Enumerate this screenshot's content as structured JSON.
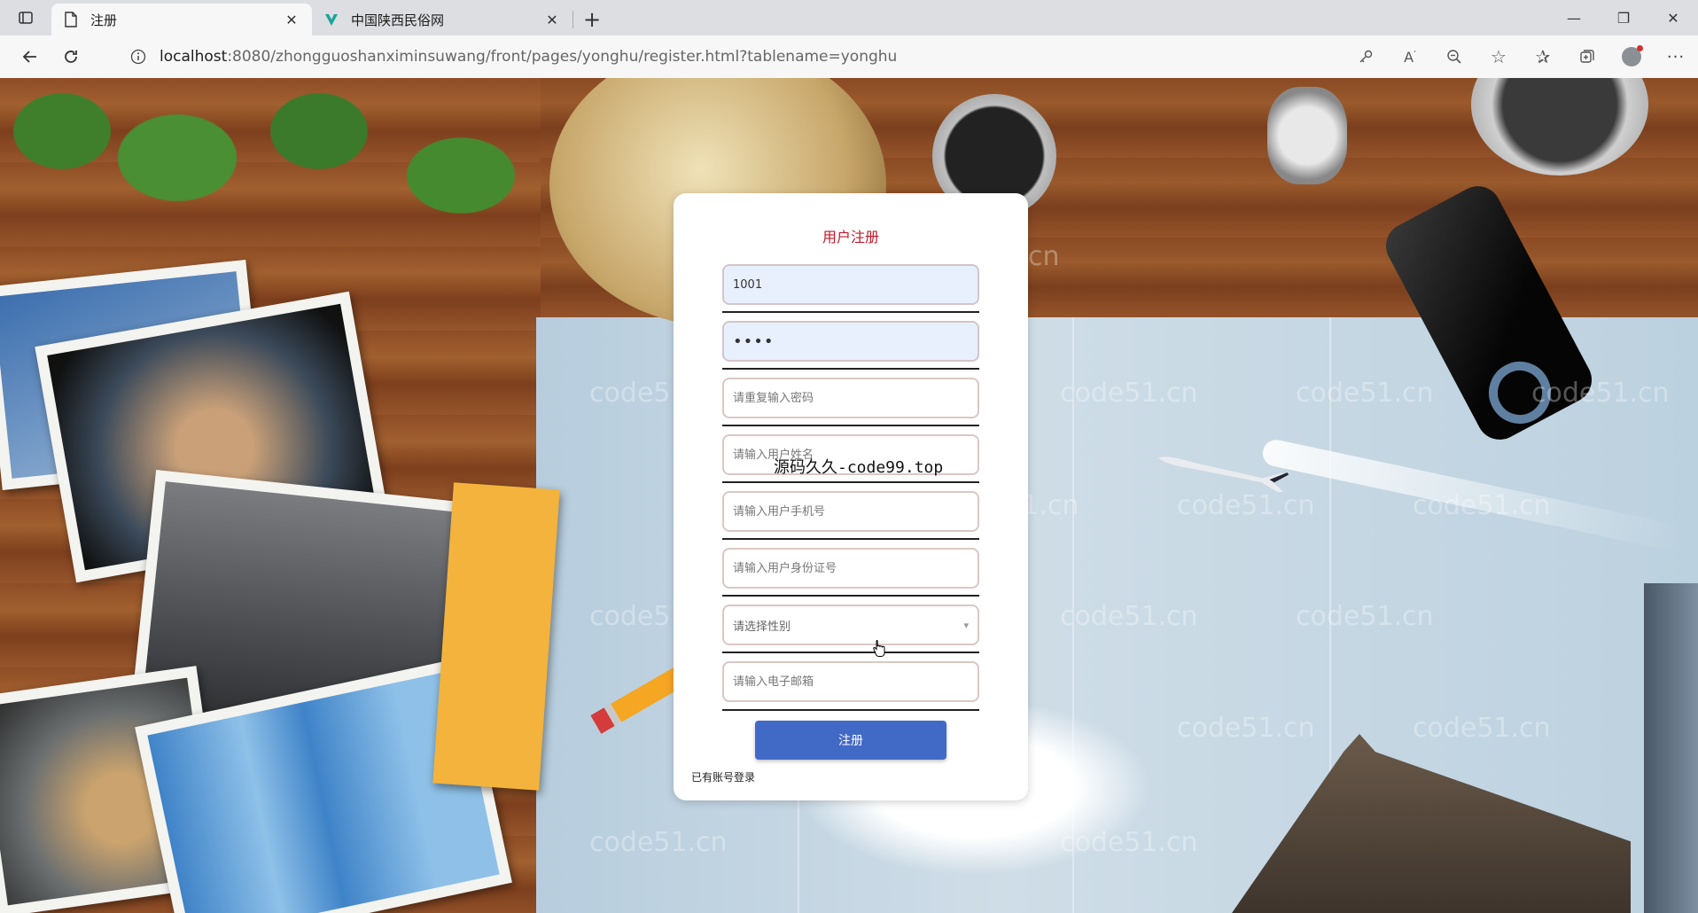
{
  "browser": {
    "tabs": [
      {
        "title": "注册",
        "active": true
      },
      {
        "title": "中国陕西民俗网",
        "active": false
      }
    ],
    "url_host": "localhost",
    "url_rest": ":8080/zhongguoshanximinsuwang/front/pages/yonghu/register.html?tablename=yonghu"
  },
  "form": {
    "title": "用户注册",
    "account_value": "1001",
    "password_value": "1234",
    "confirm_placeholder": "请重复输入密码",
    "name_placeholder": "请输入用户姓名",
    "phone_placeholder": "请输入用户手机号",
    "idcard_placeholder": "请输入用户身份证号",
    "gender_placeholder": "请选择性别",
    "email_placeholder": "请输入电子邮箱",
    "submit_label": "注册",
    "login_link": "已有账号登录"
  },
  "overlay_text": "源码久久-code99.top",
  "watermark": "code51.cn",
  "colors": {
    "title_red": "#c0182a",
    "button_blue": "#4169c6",
    "autofill_blue": "#e8f0fe"
  }
}
